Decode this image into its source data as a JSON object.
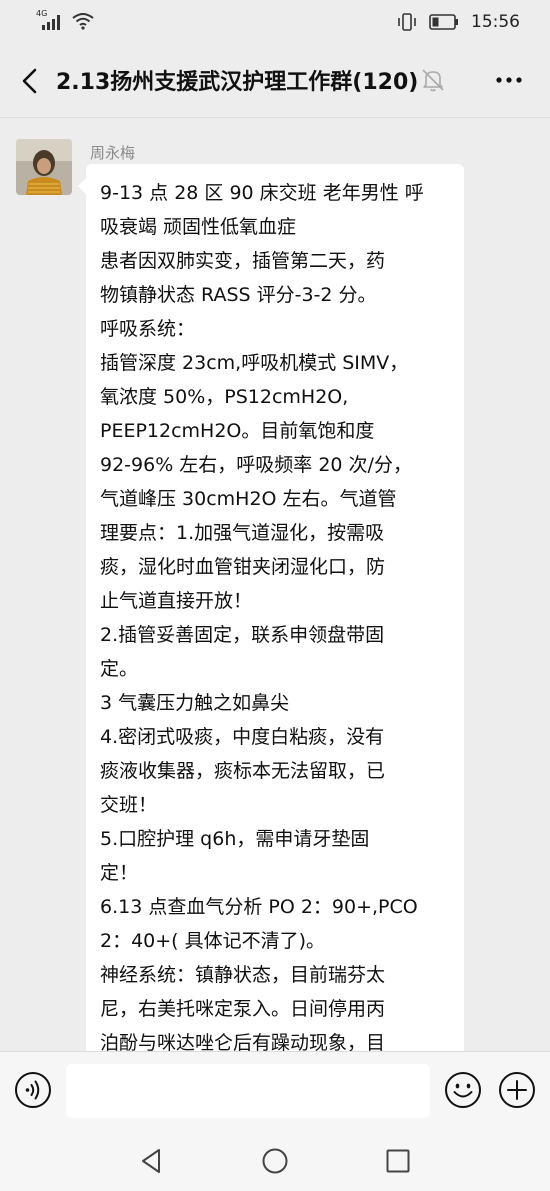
{
  "status_bar": {
    "network": "4G",
    "time": "15:56"
  },
  "header": {
    "title": "2.13扬州支援武汉护理工作群(120)"
  },
  "message": {
    "sender": "周永梅",
    "lines": [
      "9-13 点 28 区 90 床交班 老年男性 呼",
      "吸衰竭 顽固性低氧血症",
      "患者因双肺实变，插管第二天，药",
      "物镇静状态 RASS 评分-3-2 分。",
      "呼吸系统：",
      "插管深度 23cm,呼吸机模式 SIMV，",
      "氧浓度 50%，PS12cmH2O,",
      "PEEP12cmH2O。目前氧饱和度",
      "92-96% 左右，呼吸频率 20 次/分，",
      "气道峰压 30cmH2O 左右。气道管",
      "理要点：1.加强气道湿化，按需吸",
      "痰，湿化时血管钳夹闭湿化口，防",
      "止气道直接开放！",
      "2.插管妥善固定，联系申领盘带固",
      "定。",
      "3 气囊压力触之如鼻尖",
      " 4.密闭式吸痰，中度白粘痰，没有",
      "痰液收集器，痰标本无法留取，已",
      "交班！",
      "5.口腔护理 q6h，需申请牙垫固",
      "定！",
      "6.13 点查血气分析 PO 2：90+,PCO",
      "2：40+( 具体记不清了)。",
      "神经系统：镇静状态，目前瑞芬太",
      "尼，右美托咪定泵入。日间停用丙",
      "泊酚与咪达唑仑后有躁动现象，目"
    ]
  },
  "input": {
    "value": ""
  },
  "colors": {
    "background": "#ededed",
    "bubble": "#ffffff",
    "sender": "#8a8a8a"
  },
  "icons": [
    "signal-icon",
    "wifi-icon",
    "vibrate-icon",
    "battery-icon",
    "back-icon",
    "mute-bell-icon",
    "more-icon",
    "voice-icon",
    "emoji-icon",
    "plus-icon",
    "nav-back-icon",
    "nav-home-icon",
    "nav-recents-icon"
  ]
}
